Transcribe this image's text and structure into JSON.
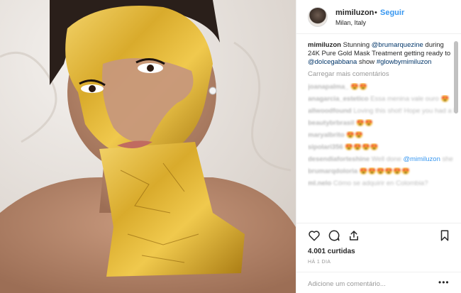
{
  "post": {
    "username": "mimiluzon",
    "follow_label": "Seguir",
    "separator": "•",
    "location": "Milan, Italy"
  },
  "caption": {
    "username": "mimiluzon",
    "text_1": " Stunning ",
    "mention_1": "@brumarquezine",
    "text_2": " during 24K Pure Gold Mask Treatment getting ready to ",
    "mention_2": "@dolcegabbana",
    "text_3": " show ",
    "hashtag": "#glowbymimiluzon"
  },
  "load_more_label": "Carregar mais comentários",
  "comments": [
    {
      "user": "joanapalma_",
      "text": "😍😍"
    },
    {
      "user": "anagarcia_estetico",
      "text": "Essa menina vale ouro 😍"
    },
    {
      "user": "allwoodfound",
      "text": "Loving this shot! Hope you had a lovely Sunday! 🤗"
    },
    {
      "user": "beautybrbrasil",
      "text": "😍😍"
    },
    {
      "user": "maryalbrito",
      "text": "😍😍"
    },
    {
      "user": "sipolari356",
      "text": "😍😍😍😍"
    },
    {
      "user": "desendiaforteshine",
      "text": "Well done",
      "mention": "@mimiluzon",
      "tail": " she is absolutely stunning"
    },
    {
      "user": "brumarqdoloria",
      "text": "😍😍😍😍😍😍"
    },
    {
      "user": "ml.nelo",
      "text": "Cómo se adquirir en Colombia?"
    }
  ],
  "likes": "4.001 curtidas",
  "time": "HÁ 1 DIA",
  "add_comment_placeholder": "Adicione um comentário...",
  "more_label": "•••",
  "colors": {
    "link_blue": "#3897f0",
    "mention_dark": "#003569",
    "gold": "#d4a62a"
  },
  "icons": [
    "heart-icon",
    "comment-icon",
    "share-icon",
    "bookmark-icon"
  ]
}
